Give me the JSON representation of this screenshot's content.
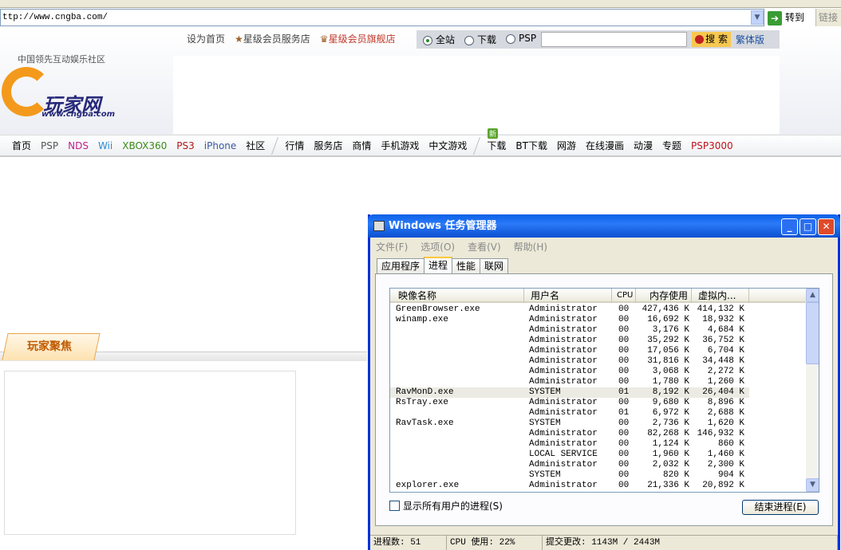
{
  "browser": {
    "url": "ttp://www.cngba.com/",
    "go_label": "转到",
    "links_label": "链接"
  },
  "site": {
    "top_links": [
      "设为首页",
      "星级会员服务店",
      "星级会员旗舰店"
    ],
    "search_scopes": [
      {
        "label": "全站",
        "selected": true
      },
      {
        "label": "下载",
        "selected": false
      },
      {
        "label": "PSP",
        "selected": false
      }
    ],
    "search_value": "",
    "search_button": "搜 索",
    "traditional": "繁体版",
    "slogan": "中国领先互动娱乐社区",
    "logo_text": "玩家网",
    "logo_url": "www.cngba.com",
    "nav_group1": [
      {
        "label": "首页",
        "color": "#000"
      },
      {
        "label": "PSP",
        "color": "#555"
      },
      {
        "label": "NDS",
        "color": "#c0208a"
      },
      {
        "label": "Wii",
        "color": "#2a8ad0"
      },
      {
        "label": "XBOX360",
        "color": "#3a8a1a"
      },
      {
        "label": "PS3",
        "color": "#b01818"
      },
      {
        "label": "iPhone",
        "color": "#3a5aa0"
      },
      {
        "label": "社区",
        "color": "#000"
      }
    ],
    "nav_group2": [
      {
        "label": "行情",
        "color": "#000"
      },
      {
        "label": "服务店",
        "color": "#000"
      },
      {
        "label": "商情",
        "color": "#000"
      },
      {
        "label": "手机游戏",
        "color": "#000"
      },
      {
        "label": "中文游戏",
        "color": "#000"
      }
    ],
    "nav_group3": [
      {
        "label": "下载",
        "color": "#000"
      },
      {
        "label": "BT下载",
        "color": "#000"
      },
      {
        "label": "网游",
        "color": "#000"
      },
      {
        "label": "在线漫画",
        "color": "#000"
      },
      {
        "label": "动漫",
        "color": "#000"
      },
      {
        "label": "专题",
        "color": "#000"
      },
      {
        "label": "PSP3000",
        "color": "#c0101a"
      }
    ],
    "new_badge": "新",
    "focus_title": "玩家聚焦"
  },
  "taskmgr": {
    "title": "Windows 任务管理器",
    "menu": [
      "文件(F)",
      "选项(O)",
      "查看(V)",
      "帮助(H)"
    ],
    "tabs": [
      {
        "label": "应用程序",
        "active": false
      },
      {
        "label": "进程",
        "active": true
      },
      {
        "label": "性能",
        "active": false
      },
      {
        "label": "联网",
        "active": false
      }
    ],
    "columns": [
      "映像名称",
      "用户名",
      "CPU",
      "内存使用",
      "虚拟内..."
    ],
    "rows": [
      {
        "name": "GreenBrowser.exe",
        "user": "Administrator",
        "cpu": "00",
        "mem": "427,436 K",
        "vm": "414,132 K"
      },
      {
        "name": "winamp.exe",
        "user": "Administrator",
        "cpu": "00",
        "mem": "16,692 K",
        "vm": "18,932 K"
      },
      {
        "name": "",
        "user": "Administrator",
        "cpu": "00",
        "mem": "3,176 K",
        "vm": "4,684 K"
      },
      {
        "name": "",
        "user": "Administrator",
        "cpu": "00",
        "mem": "35,292 K",
        "vm": "36,752 K"
      },
      {
        "name": "",
        "user": "Administrator",
        "cpu": "00",
        "mem": "17,056 K",
        "vm": "6,704 K"
      },
      {
        "name": "",
        "user": "Administrator",
        "cpu": "00",
        "mem": "31,816 K",
        "vm": "34,448 K"
      },
      {
        "name": "",
        "user": "Administrator",
        "cpu": "00",
        "mem": "3,068 K",
        "vm": "2,272 K"
      },
      {
        "name": "",
        "user": "Administrator",
        "cpu": "00",
        "mem": "1,780 K",
        "vm": "1,260 K"
      },
      {
        "name": "RavMonD.exe",
        "user": "SYSTEM",
        "cpu": "01",
        "mem": "8,192 K",
        "vm": "26,404 K",
        "selected": true
      },
      {
        "name": "RsTray.exe",
        "user": "Administrator",
        "cpu": "00",
        "mem": "9,680 K",
        "vm": "8,896 K"
      },
      {
        "name": "",
        "user": "Administrator",
        "cpu": "01",
        "mem": "6,972 K",
        "vm": "2,688 K"
      },
      {
        "name": "RavTask.exe",
        "user": "SYSTEM",
        "cpu": "00",
        "mem": "2,736 K",
        "vm": "1,620 K"
      },
      {
        "name": "",
        "user": "Administrator",
        "cpu": "00",
        "mem": "82,268 K",
        "vm": "146,932 K"
      },
      {
        "name": "",
        "user": "Administrator",
        "cpu": "00",
        "mem": "1,124 K",
        "vm": "860 K"
      },
      {
        "name": "",
        "user": "LOCAL SERVICE",
        "cpu": "00",
        "mem": "1,960 K",
        "vm": "1,460 K"
      },
      {
        "name": "",
        "user": "Administrator",
        "cpu": "00",
        "mem": "2,032 K",
        "vm": "2,300 K"
      },
      {
        "name": "",
        "user": "SYSTEM",
        "cpu": "00",
        "mem": "820 K",
        "vm": "904 K"
      },
      {
        "name": "explorer.exe",
        "user": "Administrator",
        "cpu": "00",
        "mem": "21,336 K",
        "vm": "20,892 K"
      }
    ],
    "show_all_label": "显示所有用户的进程(S)",
    "end_process_label": "结束进程(E)",
    "status": {
      "processes": "进程数: 51",
      "cpu": "CPU 使用: 22%",
      "commit": "提交更改: 1143M / 2443M"
    }
  }
}
